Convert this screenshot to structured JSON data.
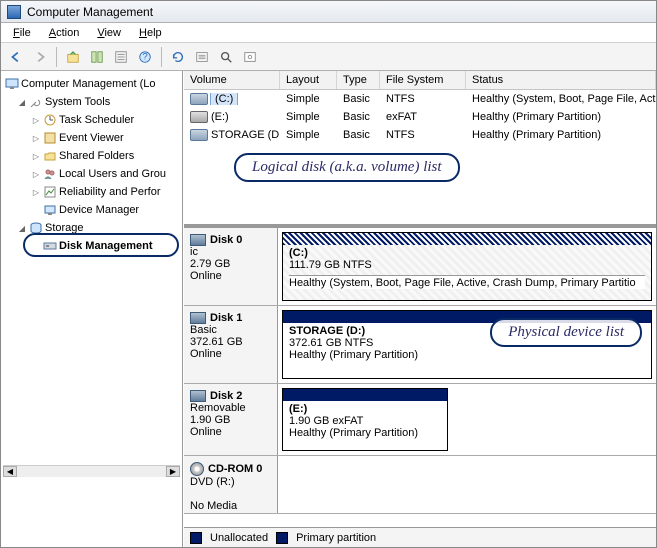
{
  "window": {
    "title": "Computer Management"
  },
  "menu": {
    "file": "File",
    "action": "Action",
    "view": "View",
    "help": "Help"
  },
  "tree": {
    "root": "Computer Management (Lo",
    "system_tools": "System Tools",
    "task_scheduler": "Task Scheduler",
    "event_viewer": "Event Viewer",
    "shared_folders": "Shared Folders",
    "local_users": "Local Users and Grou",
    "reliability": "Reliability and Perfor",
    "device_manager": "Device Manager",
    "storage": "Storage",
    "disk_management": "Disk Management"
  },
  "vol_cols": {
    "volume": "Volume",
    "layout": "Layout",
    "type": "Type",
    "fs": "File System",
    "status": "Status"
  },
  "volumes": [
    {
      "name": "(C:)",
      "layout": "Simple",
      "type": "Basic",
      "fs": "NTFS",
      "status": "Healthy (System, Boot, Page File, Active,"
    },
    {
      "name": "(E:)",
      "layout": "Simple",
      "type": "Basic",
      "fs": "exFAT",
      "status": "Healthy (Primary Partition)"
    },
    {
      "name": "STORAGE (D:)",
      "layout": "Simple",
      "type": "Basic",
      "fs": "NTFS",
      "status": "Healthy (Primary Partition)"
    }
  ],
  "annotations": {
    "volume_list": "Logical disk (a.k.a. volume) list",
    "device_list": "Physical device list"
  },
  "disks": [
    {
      "name": "Disk 0",
      "typeline": "ic",
      "size": "2.79 GB",
      "status": "Online",
      "part": {
        "label": "(C:)",
        "size": "111.79 GB NTFS",
        "health": "Healthy (System, Boot, Page File, Active, Crash Dump, Primary Partitio"
      }
    },
    {
      "name": "Disk 1",
      "typeline": "Basic",
      "size": "372.61 GB",
      "status": "Online",
      "part": {
        "label": "STORAGE  (D:)",
        "size": "372.61 GB NTFS",
        "health": "Healthy (Primary Partition)"
      }
    },
    {
      "name": "Disk 2",
      "typeline": "Removable",
      "size": "1.90 GB",
      "status": "Online",
      "part": {
        "label": "(E:)",
        "size": "1.90 GB exFAT",
        "health": "Healthy (Primary Partition)"
      }
    },
    {
      "name": "CD-ROM 0",
      "typeline": "DVD (R:)",
      "size": "",
      "status": "No Media",
      "part": null
    }
  ],
  "legend": {
    "unallocated": "Unallocated",
    "primary": "Primary partition"
  }
}
